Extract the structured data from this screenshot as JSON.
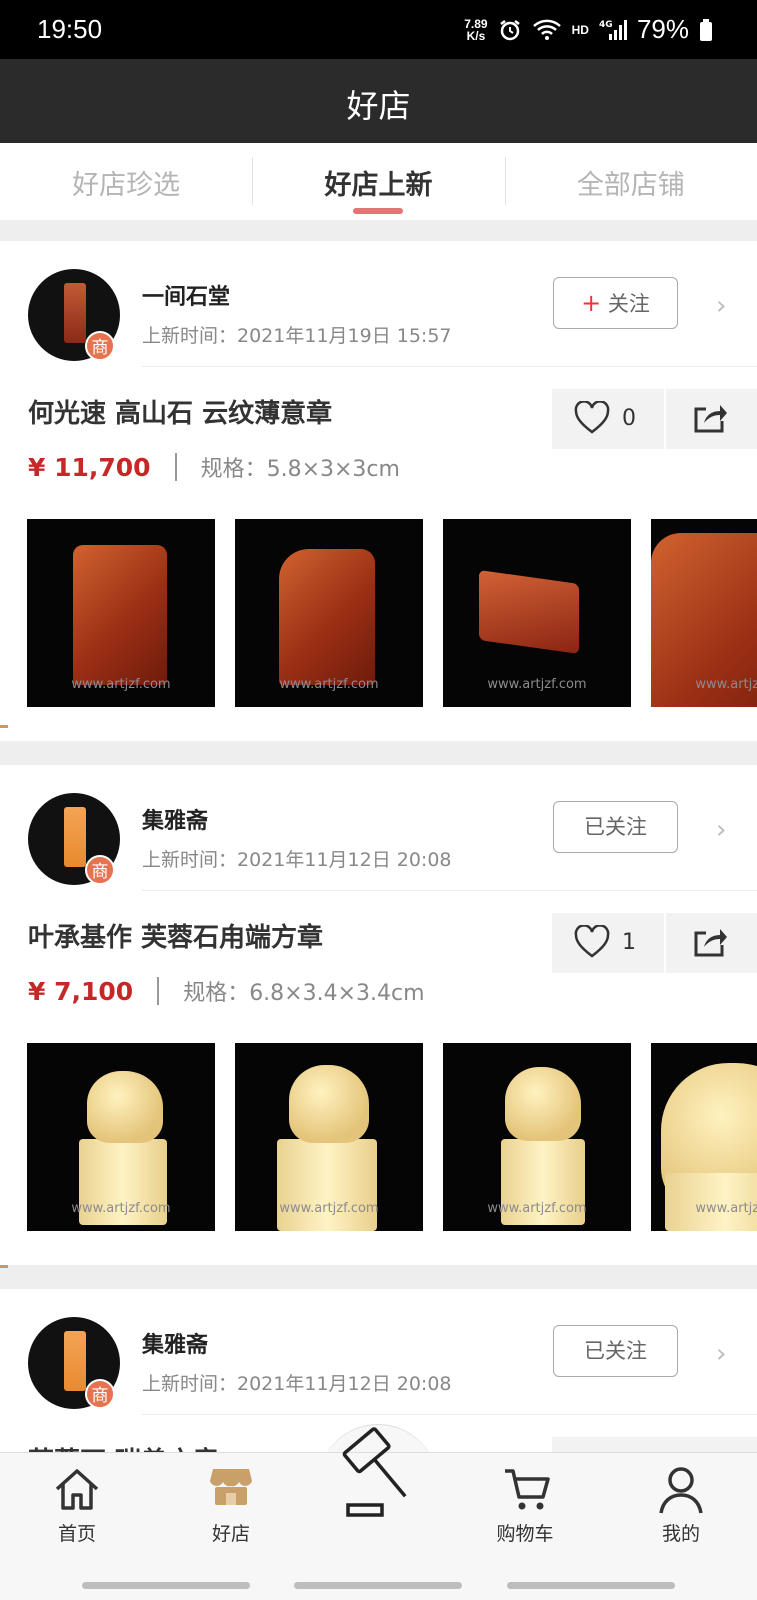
{
  "status_bar": {
    "time": "19:50",
    "net_speed_value": "7.89",
    "net_speed_unit": "K/s",
    "hd_label": "HD",
    "network": "4G",
    "battery": "79%"
  },
  "header": {
    "title": "好店"
  },
  "tabs": [
    {
      "label": "好店珍选",
      "active": false
    },
    {
      "label": "好店上新",
      "active": true
    },
    {
      "label": "全部店铺",
      "active": false
    }
  ],
  "cards": [
    {
      "shop_name": "一间石堂",
      "update_time": "上新时间：2021年11月19日 15:57",
      "badge": "商",
      "follow_plus": "+",
      "follow_label": "关注",
      "item_title": "何光速 高山石 云纹薄意章",
      "likes": "0",
      "price": "¥ 11,700",
      "spec": "规格：5.8×3×3cm",
      "watermark": "www.artjzf.com",
      "seal_color": "#b5452a"
    },
    {
      "shop_name": "集雅斋",
      "update_time": "上新时间：2021年11月12日 20:08",
      "badge": "商",
      "follow_label": "已关注",
      "item_title": "叶承基作 芙蓉石甪端方章",
      "likes": "1",
      "price": "¥ 7,100",
      "spec": "规格：6.8×3.4×3.4cm",
      "watermark": "www.artjzf.com",
      "seal_color": "#f0a04b"
    },
    {
      "shop_name": "集雅斋",
      "update_time": "上新时间：2021年11月12日 20:08",
      "badge": "商",
      "follow_label": "已关注",
      "item_title": "芙蓉石 瑞兽方章",
      "seal_color": "#f0a04b"
    }
  ],
  "bottom_nav": [
    {
      "label": "首页",
      "icon": "home-icon"
    },
    {
      "label": "好店",
      "icon": "shop-icon",
      "active": true
    },
    {
      "label": "",
      "icon": "auction-hammer-icon"
    },
    {
      "label": "购物车",
      "icon": "cart-icon"
    },
    {
      "label": "我的",
      "icon": "user-icon"
    }
  ],
  "colors": {
    "accent_red": "#c62828",
    "tab_indicator": "#e57373",
    "header_bg": "#2b2b2b",
    "shop_icon_active": "#c9a06a"
  }
}
